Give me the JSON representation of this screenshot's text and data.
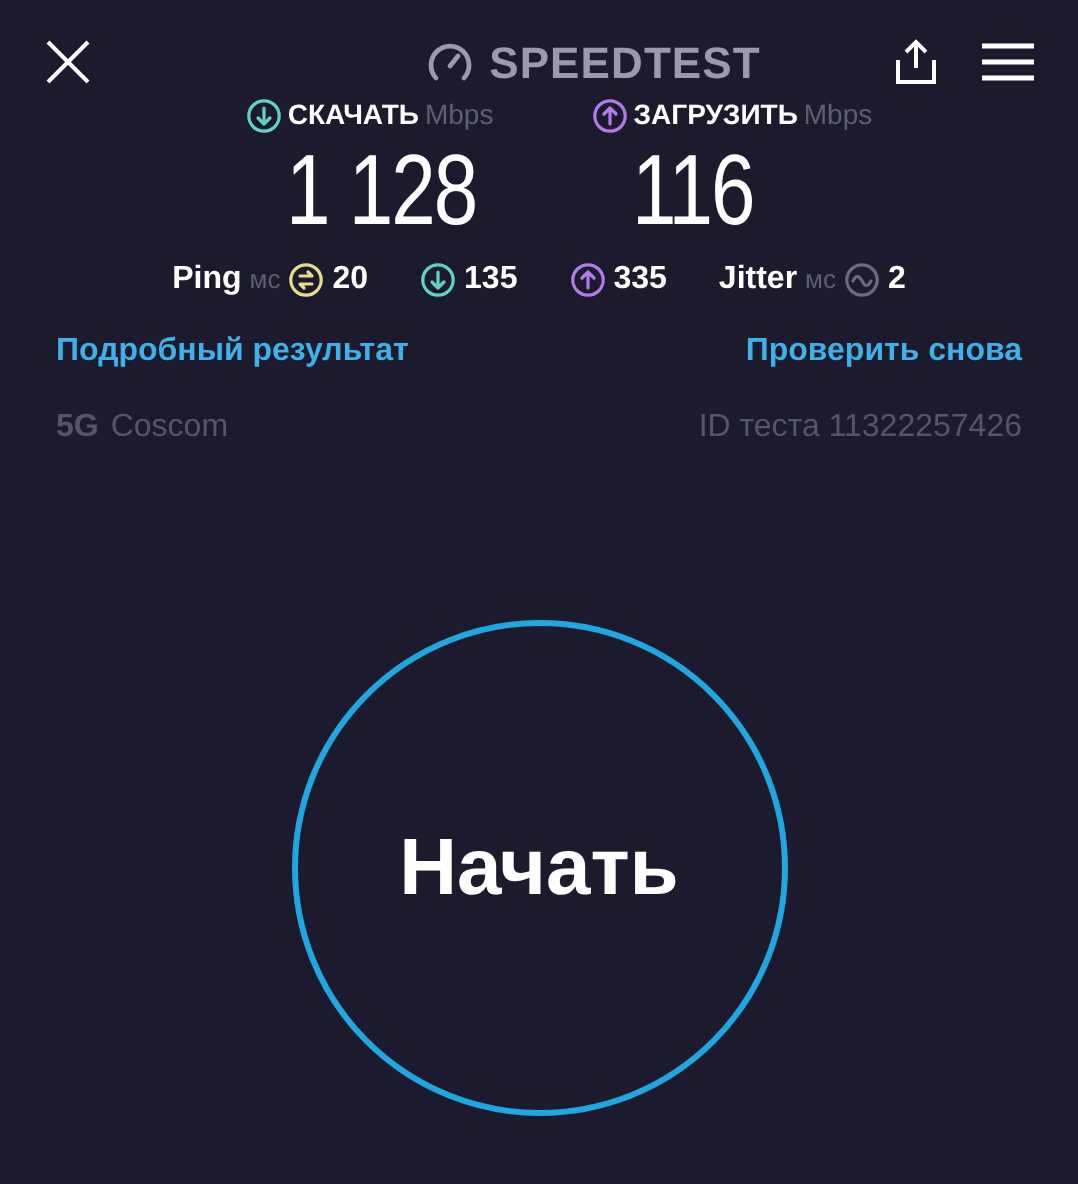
{
  "header": {
    "title": "SPEEDTEST"
  },
  "speeds": [
    {
      "kind": "download",
      "label": "СКАЧАТЬ",
      "unit": "Mbps",
      "value": "1 128"
    },
    {
      "kind": "upload",
      "label": "ЗАГРУЗИТЬ",
      "unit": "Mbps",
      "value": "116"
    }
  ],
  "stats": [
    {
      "kind": "ping",
      "label": "Ping",
      "unit": "мс",
      "value": "20"
    },
    {
      "kind": "download",
      "value": "135"
    },
    {
      "kind": "upload",
      "value": "335"
    },
    {
      "kind": "jitter",
      "label": "Jitter",
      "unit": "мс",
      "value": "2"
    }
  ],
  "links": [
    "Подробный результат",
    "Проверить снова"
  ],
  "network": {
    "type": "5G",
    "provider": "Coscom"
  },
  "test_id": "ID теста 11322257426",
  "start_button": "Начать"
}
